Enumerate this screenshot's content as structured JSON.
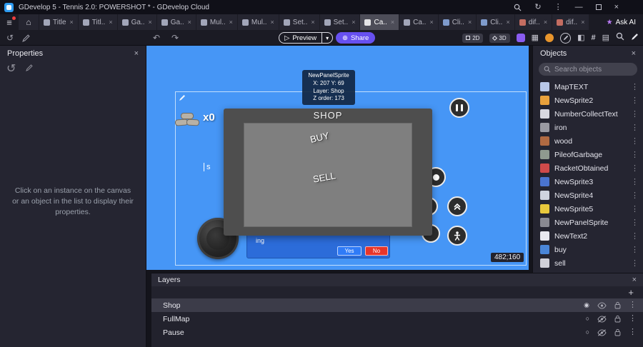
{
  "titlebar": {
    "title": "GDevelop 5 - Tennis 2.0: POWERSHOT * - GDevelop Cloud"
  },
  "icons": {
    "menu": "≡",
    "home": "⌂",
    "close": "×",
    "kebab": "⋮",
    "minimize": "—",
    "refresh": "↻",
    "history": "↺",
    "undo": "↶",
    "redo": "↷",
    "play": "▷",
    "caret_down": "▾",
    "share": "⊕",
    "sparkle": "★",
    "objects_grid": "▦",
    "mask": "◧",
    "grid_hash": "#",
    "layers": "▤",
    "radio_on": "◉",
    "radio_off": "○",
    "plus": "+"
  },
  "colors": {
    "accent_purple": "#6750f0",
    "canvas_blue": "#4696f6",
    "yes_button_blue": "#2f7bf7",
    "no_button_red": "#e8352a",
    "selected_row": "#3c3c49"
  },
  "tabbar": {
    "active_index": 8,
    "ask_ai_label": "Ask AI",
    "items": [
      {
        "label": "Title",
        "icon_color": "#b9bdd1"
      },
      {
        "label": "Titl..",
        "icon_color": "#b9bdd1"
      },
      {
        "label": "Ga..",
        "icon_color": "#b9bdd1"
      },
      {
        "label": "Ga..",
        "icon_color": "#b9bdd1"
      },
      {
        "label": "Mul..",
        "icon_color": "#b9bdd1"
      },
      {
        "label": "Mul..",
        "icon_color": "#b9bdd1"
      },
      {
        "label": "Set..",
        "icon_color": "#b9bdd1"
      },
      {
        "label": "Set..",
        "icon_color": "#b9bdd1"
      },
      {
        "label": "Ca..",
        "icon_color": "#ffffff"
      },
      {
        "label": "Ca..",
        "icon_color": "#b9bdd1"
      },
      {
        "label": "Cli..",
        "icon_color": "#8fb0e8"
      },
      {
        "label": "Cli..",
        "icon_color": "#8fb0e8"
      },
      {
        "label": "dif..",
        "icon_color": "#e07a6a"
      },
      {
        "label": "dif..",
        "icon_color": "#e07a6a"
      }
    ]
  },
  "toolbar": {
    "preview_label": "Preview",
    "share_label": "Share",
    "mode_2d": "2D",
    "mode_3d": "3D"
  },
  "properties_panel": {
    "title": "Properties",
    "empty_message": "Click on an instance on the canvas or an object in the list to display their properties."
  },
  "canvas": {
    "selection_tooltip": {
      "title": "NewPanelSprite",
      "coords": "X: 207  Y: 69",
      "layer": "Layer: Shop",
      "z_order": "Z order: 173"
    },
    "shop_panel": {
      "title": "SHOP",
      "buy_label": "BUY",
      "sell_label": "SELL"
    },
    "wood_counter": "x0",
    "partial_text": "s",
    "confirm_dialog": {
      "message_fragment": "ing",
      "yes_label": "Yes",
      "no_label": "No"
    },
    "cursor_coordinates": "482;160"
  },
  "objects_panel": {
    "title": "Objects",
    "search_placeholder": "Search objects",
    "items": [
      {
        "label": "MapTEXT",
        "color": "#b8c7e8"
      },
      {
        "label": "NewSprite2",
        "color": "#e8a13c"
      },
      {
        "label": "NumberCollectText",
        "color": "#d8d8e0"
      },
      {
        "label": "iron",
        "color": "#9a9aa2"
      },
      {
        "label": "wood",
        "color": "#b06a42"
      },
      {
        "label": "PileofGarbage",
        "color": "#8f9a8f"
      },
      {
        "label": "RacketObtained",
        "color": "#cf4a4a"
      },
      {
        "label": "NewSprite3",
        "color": "#4a74cf"
      },
      {
        "label": "NewSprite4",
        "color": "#cfd4df"
      },
      {
        "label": "NewSprite5",
        "color": "#e8c83c"
      },
      {
        "label": "NewPanelSprite",
        "color": "#8a8a92"
      },
      {
        "label": "NewText2",
        "color": "#e8e8f0"
      },
      {
        "label": "buy",
        "color": "#4a86d8"
      },
      {
        "label": "sell",
        "color": "#d0d0d8"
      }
    ]
  },
  "layers_panel": {
    "title": "Layers",
    "items": [
      {
        "label": "Shop",
        "selected": true,
        "visible": true
      },
      {
        "label": "FullMap",
        "selected": false,
        "visible": false
      },
      {
        "label": "Pause",
        "selected": false,
        "visible": false
      }
    ]
  }
}
